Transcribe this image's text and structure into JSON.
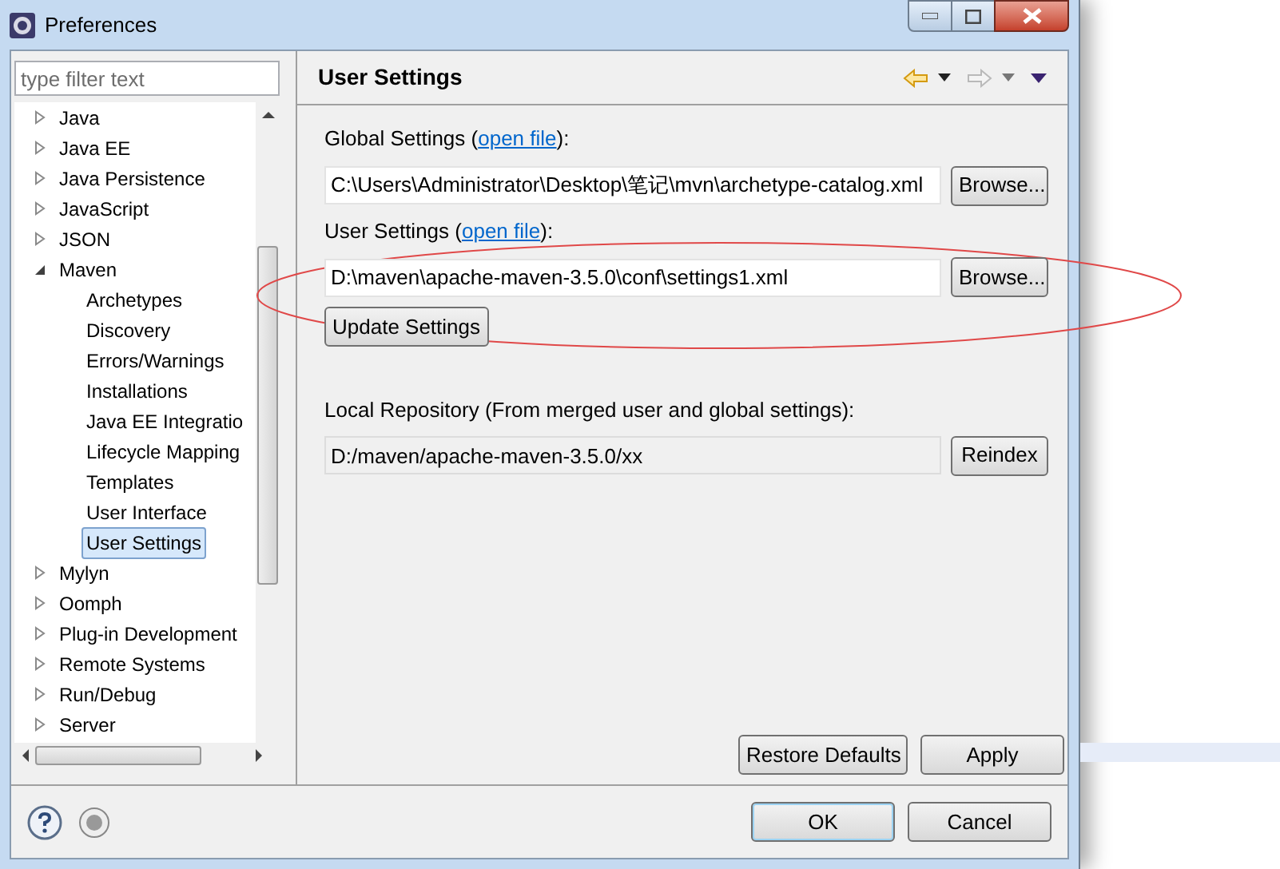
{
  "window": {
    "title": "Preferences"
  },
  "filter": {
    "placeholder": "type filter text"
  },
  "tree": [
    {
      "label": "Java",
      "expanded": false,
      "selected": false
    },
    {
      "label": "Java EE",
      "expanded": false,
      "selected": false
    },
    {
      "label": "Java Persistence",
      "expanded": false,
      "selected": false
    },
    {
      "label": "JavaScript",
      "expanded": false,
      "selected": false
    },
    {
      "label": "JSON",
      "expanded": false,
      "selected": false
    },
    {
      "label": "Maven",
      "expanded": true,
      "selected": false,
      "children": [
        {
          "label": "Archetypes",
          "selected": false
        },
        {
          "label": "Discovery",
          "selected": false
        },
        {
          "label": "Errors/Warnings",
          "selected": false
        },
        {
          "label": "Installations",
          "selected": false
        },
        {
          "label": "Java EE Integratio",
          "selected": false
        },
        {
          "label": "Lifecycle Mapping",
          "selected": false
        },
        {
          "label": "Templates",
          "selected": false
        },
        {
          "label": "User Interface",
          "selected": false
        },
        {
          "label": "User Settings",
          "selected": true
        }
      ]
    },
    {
      "label": "Mylyn",
      "expanded": false,
      "selected": false
    },
    {
      "label": "Oomph",
      "expanded": false,
      "selected": false
    },
    {
      "label": "Plug-in Development",
      "expanded": false,
      "selected": false
    },
    {
      "label": "Remote Systems",
      "expanded": false,
      "selected": false
    },
    {
      "label": "Run/Debug",
      "expanded": false,
      "selected": false
    },
    {
      "label": "Server",
      "expanded": false,
      "selected": false
    }
  ],
  "page": {
    "title": "User Settings",
    "global": {
      "label": "Global Settings (",
      "link": "open file",
      "suffix": "):",
      "value": "C:\\Users\\Administrator\\Desktop\\笔记\\mvn\\archetype-catalog.xml",
      "button": "Browse..."
    },
    "user": {
      "label": "User Settings (",
      "link": "open file",
      "suffix": "):",
      "value": "D:\\maven\\apache-maven-3.5.0\\conf\\settings1.xml",
      "button": "Browse..."
    },
    "update_button": "Update Settings",
    "local": {
      "label": "Local Repository (From merged user and global settings):",
      "value": "D:/maven/apache-maven-3.5.0/xx",
      "button": "Reindex"
    },
    "restore_button": "Restore Defaults",
    "apply_button": "Apply"
  },
  "buttons": {
    "ok": "OK",
    "cancel": "Cancel"
  }
}
